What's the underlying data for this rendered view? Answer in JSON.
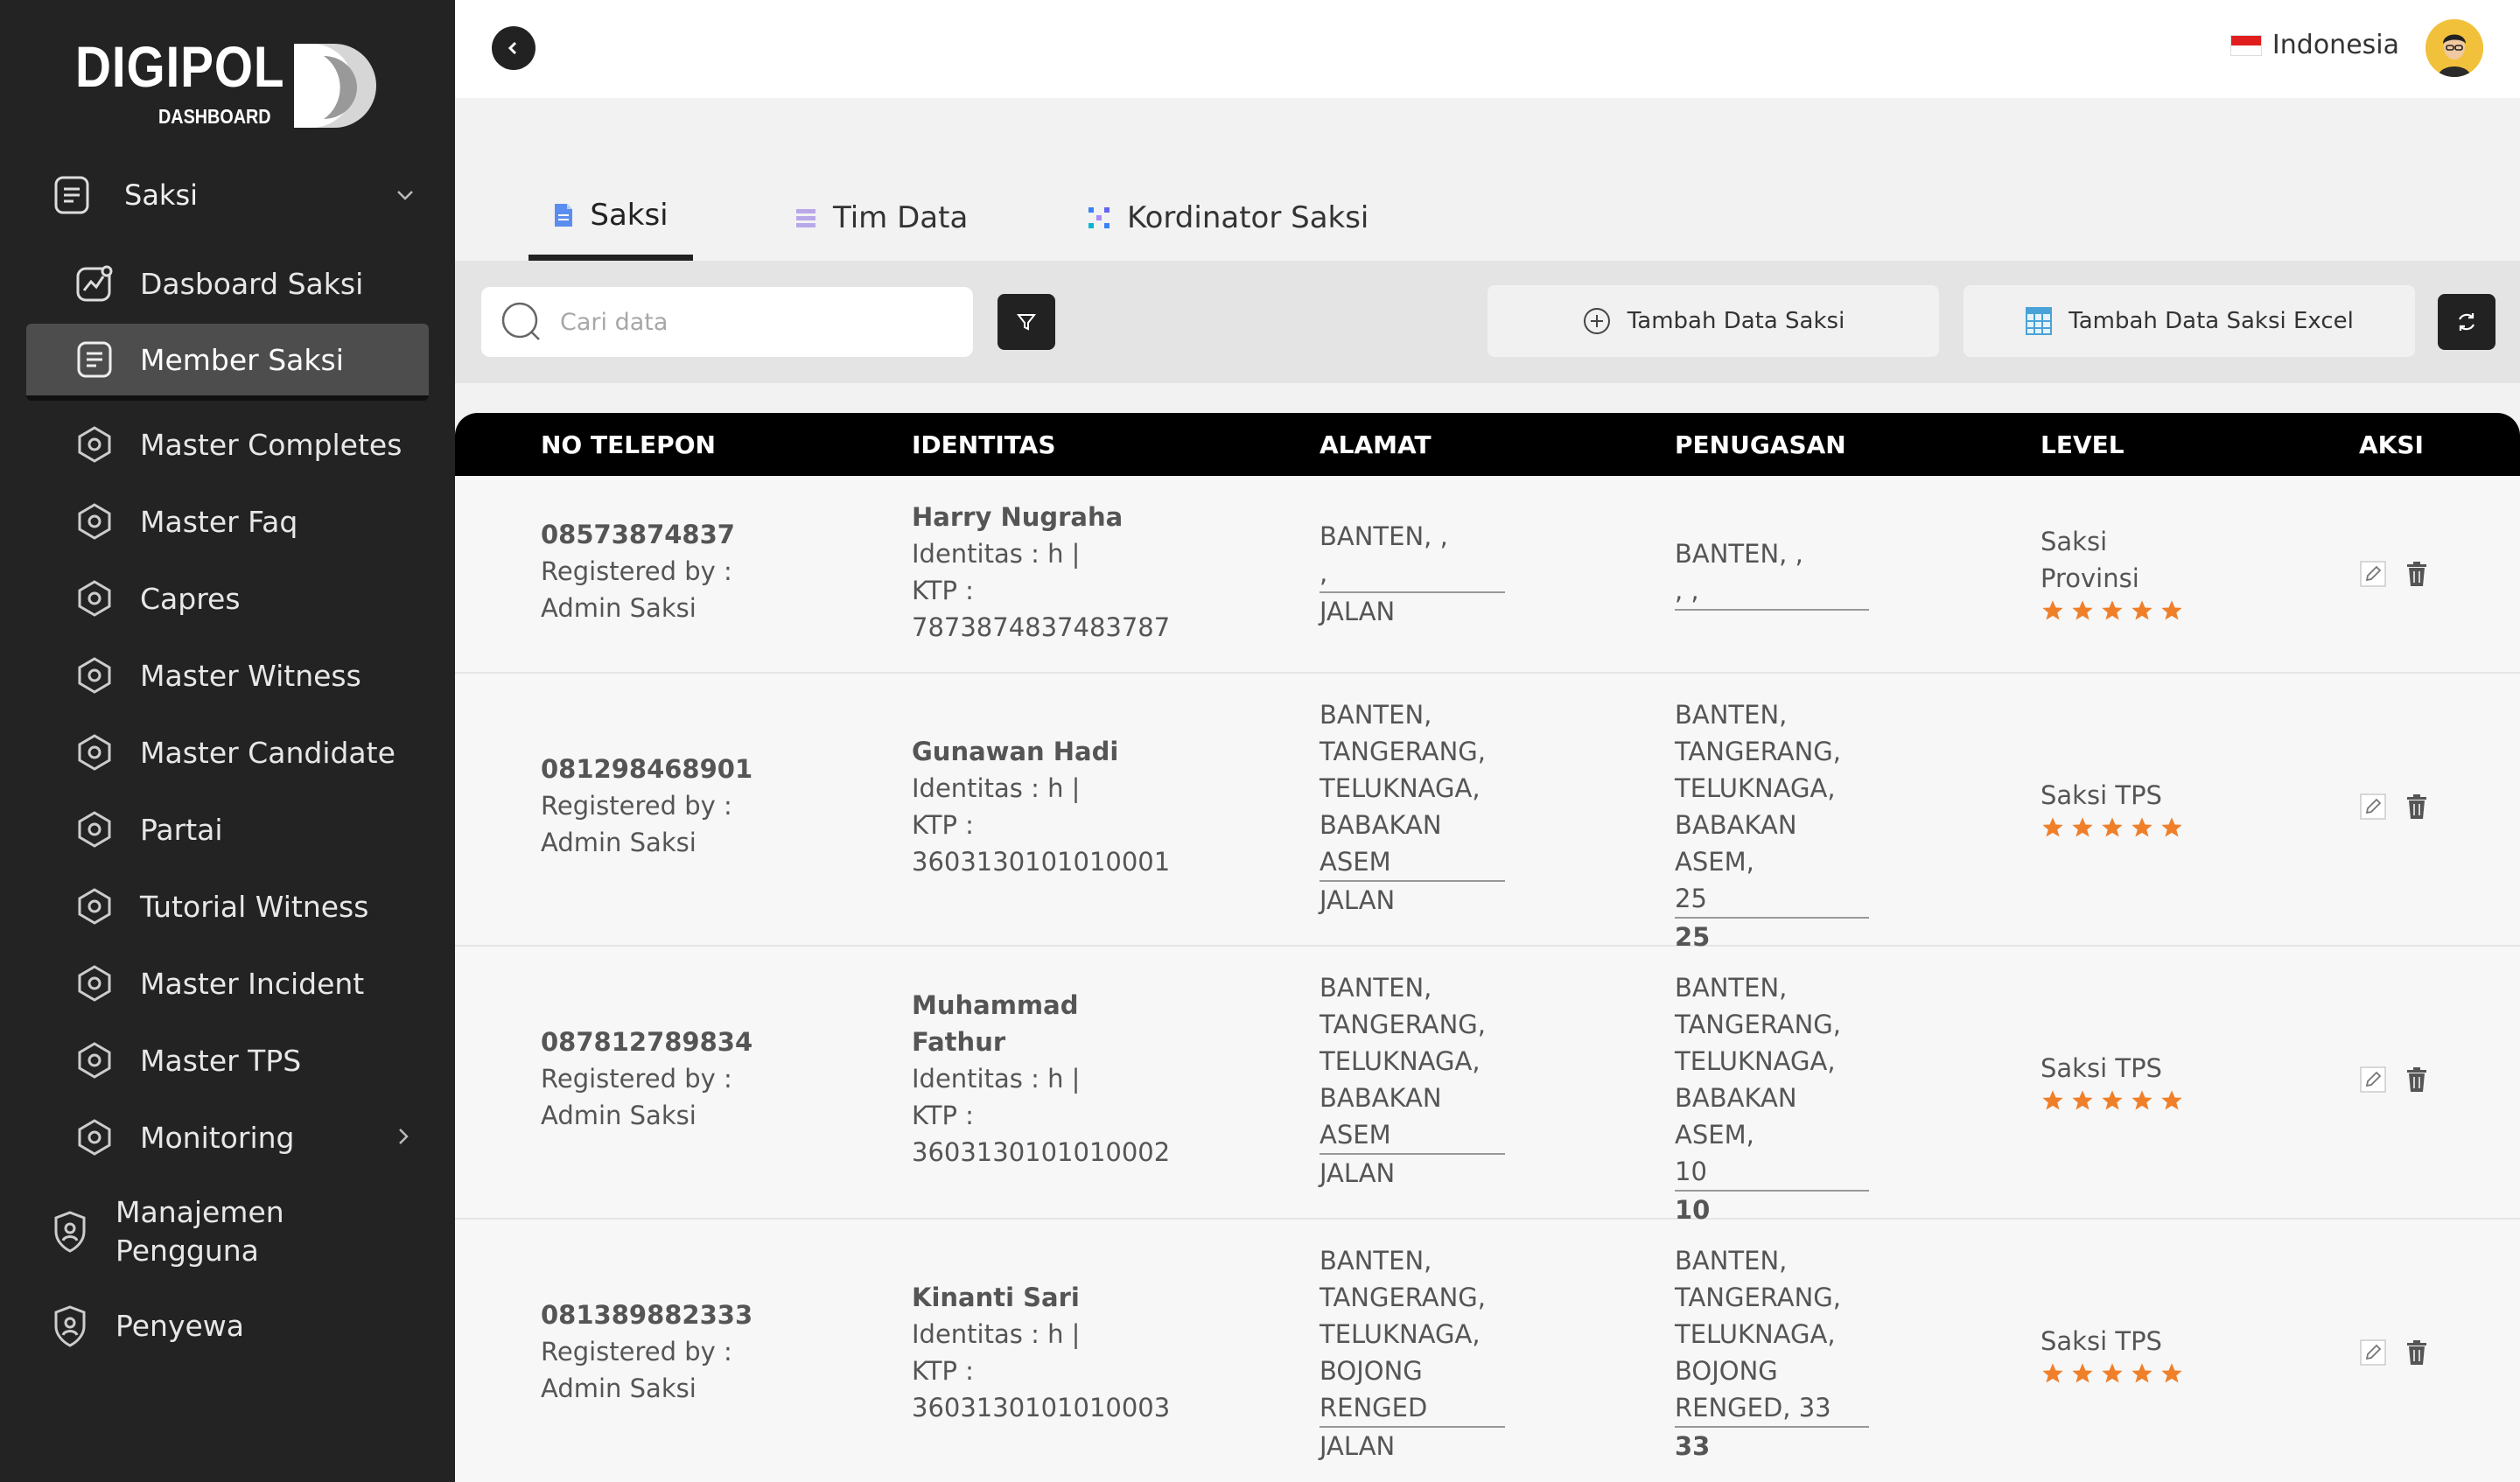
{
  "brand": {
    "name": "DIGIPOL",
    "sub": "DASHBOARD"
  },
  "sidebar": {
    "section": {
      "label": "Saksi",
      "icon": "document-icon",
      "state": "expanded"
    },
    "items": [
      {
        "label": "Dasboard Saksi",
        "icon": "chart-icon"
      },
      {
        "label": "Member Saksi",
        "icon": "document-icon",
        "active": true
      },
      {
        "label": "Master Completes",
        "icon": "hexagon-icon"
      },
      {
        "label": "Master Faq",
        "icon": "hexagon-icon"
      },
      {
        "label": "Capres",
        "icon": "hexagon-icon"
      },
      {
        "label": "Master Witness",
        "icon": "hexagon-icon"
      },
      {
        "label": "Master Candidate",
        "icon": "hexagon-icon"
      },
      {
        "label": "Partai",
        "icon": "hexagon-icon"
      },
      {
        "label": "Tutorial Witness",
        "icon": "hexagon-icon"
      },
      {
        "label": "Master Incident",
        "icon": "hexagon-icon"
      },
      {
        "label": "Master TPS",
        "icon": "hexagon-icon"
      },
      {
        "label": "Monitoring",
        "icon": "hexagon-icon",
        "has_submenu": true
      }
    ],
    "bottom": [
      {
        "label_1": "Manajemen",
        "label_2": "Pengguna",
        "icon": "user-shield-icon"
      },
      {
        "label_1": "Penyewa",
        "icon": "user-shield-icon"
      }
    ]
  },
  "topbar": {
    "language": "Indonesia",
    "flag": "indonesia-flag-icon"
  },
  "tabs": [
    {
      "label": "Saksi",
      "active": true
    },
    {
      "label": "Tim Data"
    },
    {
      "label": "Kordinator Saksi"
    }
  ],
  "toolbar": {
    "search_placeholder": "Cari data",
    "add_button": "Tambah Data Saksi",
    "add_excel_button": "Tambah Data Saksi Excel"
  },
  "table": {
    "columns": [
      "NO TELEPON",
      "IDENTITAS",
      "ALAMAT",
      "PENUGASAN",
      "LEVEL",
      "AKSI"
    ],
    "rows": [
      {
        "phone": "08573874837",
        "reg_label": "Registered by :",
        "reg_by": "Admin Saksi",
        "name": "Harry Nugraha",
        "identitas": "Identitas : h |",
        "ktp_label": "KTP :",
        "ktp": "7873874837483787",
        "alamat_top": "BANTEN, ,\n,",
        "alamat_bottom": "JALAN",
        "tugas_top": "BANTEN, ,\n, ,",
        "tugas_bottom": "",
        "level": "Saksi\nProvinsi",
        "rating": 5
      },
      {
        "phone": "081298468901",
        "reg_label": "Registered by :",
        "reg_by": "Admin Saksi",
        "name": "Gunawan Hadi",
        "identitas": "Identitas : h |",
        "ktp_label": "KTP :",
        "ktp": "3603130101010001",
        "alamat_top": "BANTEN,\nTANGERANG,\nTELUKNAGA,\nBABAKAN\nASEM",
        "alamat_bottom": "JALAN",
        "tugas_top": "BANTEN,\nTANGERANG,\nTELUKNAGA,\nBABAKAN ASEM,\n25",
        "tugas_bottom": "25",
        "level": "Saksi TPS",
        "rating": 5
      },
      {
        "phone": "087812789834",
        "reg_label": "Registered by :",
        "reg_by": "Admin Saksi",
        "name": "Muhammad\nFathur",
        "identitas": "Identitas : h |",
        "ktp_label": "KTP :",
        "ktp": "3603130101010002",
        "alamat_top": "BANTEN,\nTANGERANG,\nTELUKNAGA,\nBABAKAN\nASEM",
        "alamat_bottom": "JALAN",
        "tugas_top": "BANTEN,\nTANGERANG,\nTELUKNAGA,\nBABAKAN ASEM,\n10",
        "tugas_bottom": "10",
        "level": "Saksi TPS",
        "rating": 5
      },
      {
        "phone": "081389882333",
        "reg_label": "Registered by :",
        "reg_by": "Admin Saksi",
        "name": "Kinanti Sari",
        "identitas": "Identitas : h |",
        "ktp_label": "KTP :",
        "ktp": "3603130101010003",
        "alamat_top": "BANTEN,\nTANGERANG,\nTELUKNAGA,\nBOJONG\nRENGED",
        "alamat_bottom": "JALAN",
        "tugas_top": "BANTEN,\nTANGERANG,\nTELUKNAGA,\nBOJONG\nRENGED, 33",
        "tugas_bottom": "33",
        "level": "Saksi TPS",
        "rating": 5
      }
    ]
  },
  "colors": {
    "sidebar": "#232323",
    "star": "#f07f2a",
    "active_item": "#4d4d4d"
  }
}
